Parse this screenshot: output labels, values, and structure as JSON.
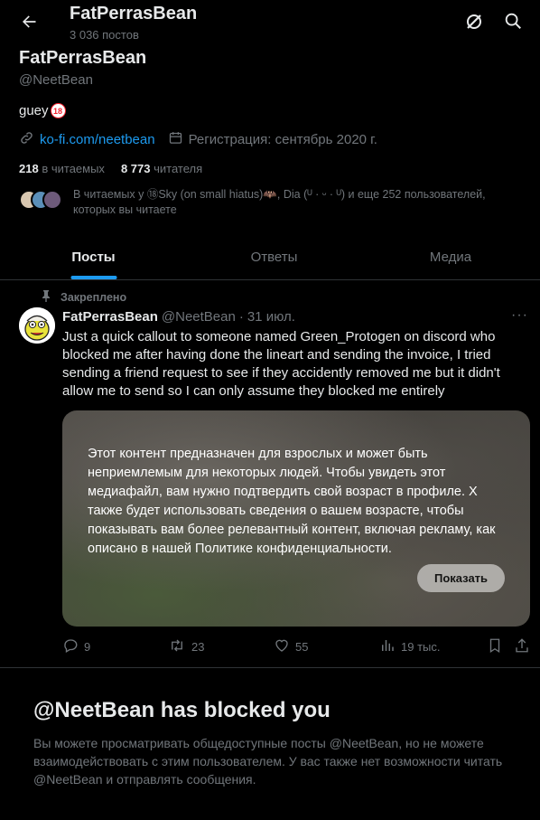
{
  "header": {
    "title": "FatPerrasBean",
    "subtitle": "3 036 постов"
  },
  "profile": {
    "name": "FatPerrasBean",
    "handle": "@NeetBean",
    "bio": "guey",
    "bio_badge": "18",
    "link": "ko-fi.com/neetbean",
    "registration": "Регистрация: сентябрь 2020 г.",
    "following_count": "218",
    "following_label": "в читаемых",
    "followers_count": "8 773",
    "followers_label": "читателя",
    "followers_you_know": "В читаемых у ⑱Sky (on small hiatus)🦇, Dia (ᵁ · ᵕ · ᵁ) и еще 252 пользователей, которых вы читаете"
  },
  "tabs": [
    "Посты",
    "Ответы",
    "Медиа"
  ],
  "pinned_tweet": {
    "pinned_label": "Закреплено",
    "author_name": "FatPerrasBean",
    "author_handle": "@NeetBean",
    "separator": "·",
    "date": "31 июл.",
    "text": "Just a quick callout to someone named Green_Protogen on discord who blocked me after having done the lineart and sending the invoice, I tried sending a friend request to see if they accidently removed me but it didn't allow me to send so I can only assume they blocked me entirely",
    "media_warning": "Этот контент предназначен для взрослых и может быть неприемлемым для некоторых людей. Чтобы увидеть этот медиафайл, вам нужно подтвердить свой возраст в профиле. X также будет использовать сведения о вашем возрасте, чтобы показывать вам более релевантный контент, включая рекламу, как описано в нашей Политике конфиденциальности.",
    "show_button": "Показать",
    "replies": "9",
    "retweets": "23",
    "likes": "55",
    "views": "19 тыс."
  },
  "blocked": {
    "title": "@NeetBean has blocked you",
    "text": "Вы можете просматривать общедоступные посты @NeetBean, но не можете взаимодействовать с этим пользователем. У вас также нет возможности читать @NeetBean и отправлять сообщения."
  },
  "colors": {
    "accent": "#1d9bf0",
    "background": "#000000",
    "text": "#e7e9ea",
    "secondary_text": "#71767b"
  }
}
